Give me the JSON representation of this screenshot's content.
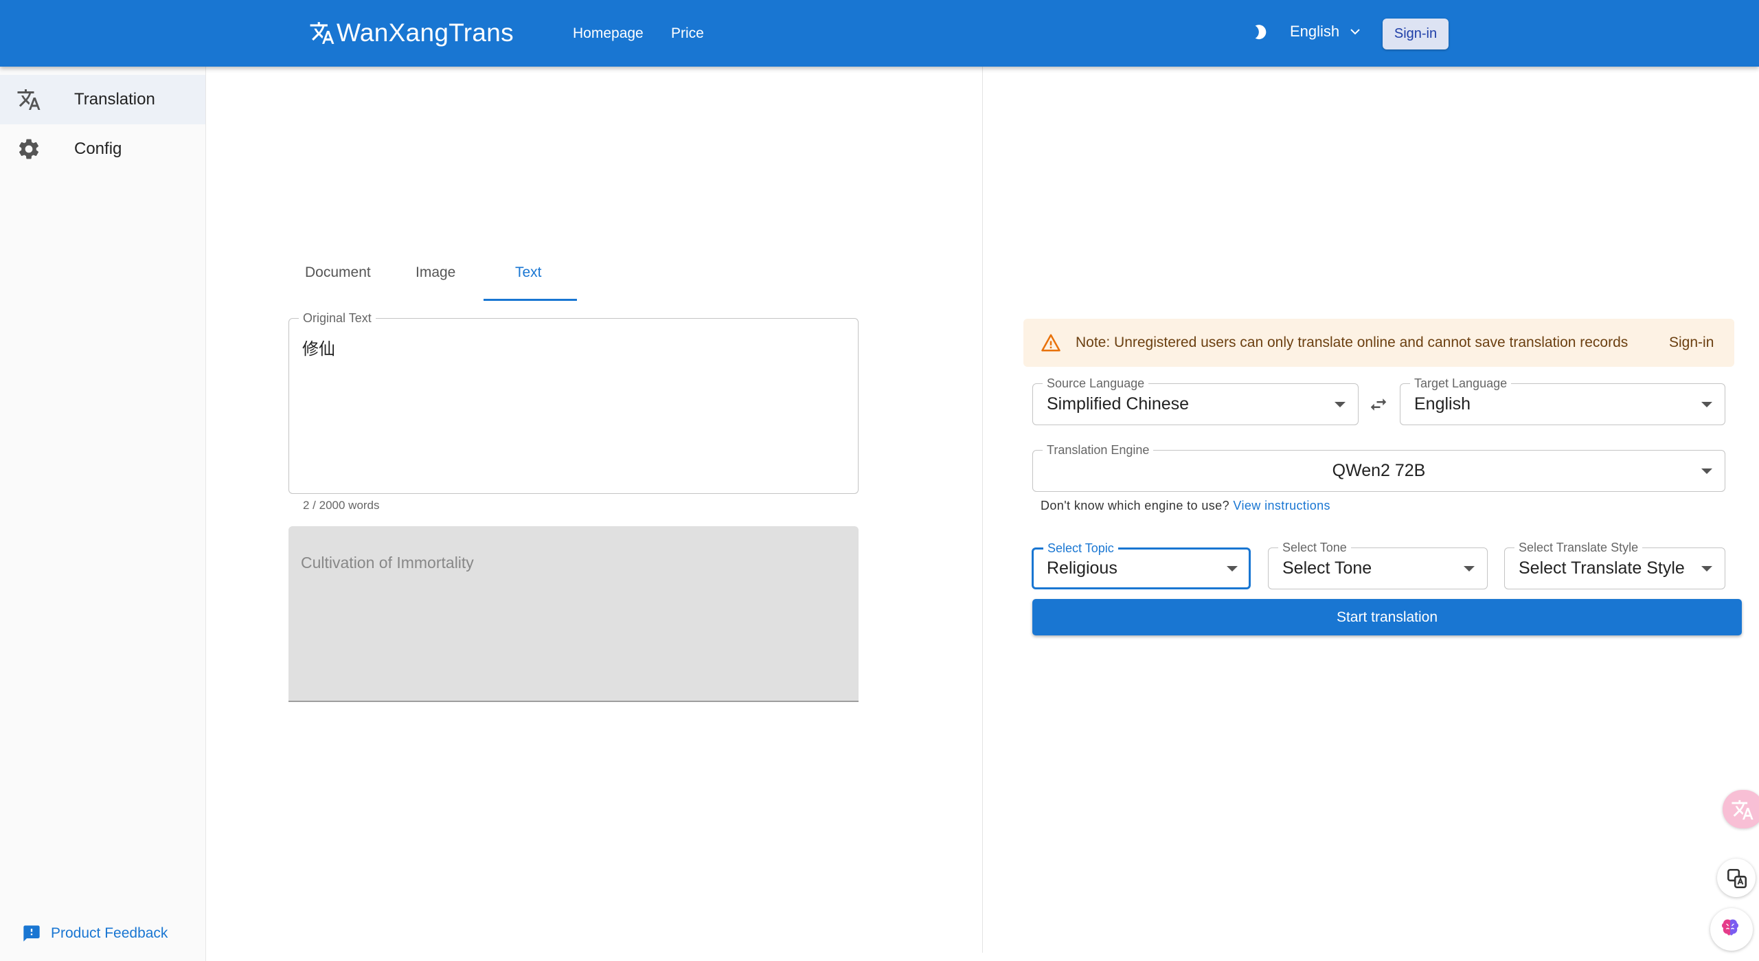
{
  "header": {
    "brand": "WanXangTrans",
    "nav": [
      "Homepage",
      "Price"
    ],
    "language": "English",
    "signin": "Sign-in"
  },
  "sidebar": {
    "items": [
      {
        "label": "Translation",
        "icon": "translate-icon",
        "active": true
      },
      {
        "label": "Config",
        "icon": "gear-icon",
        "active": false
      }
    ],
    "feedback": "Product Feedback"
  },
  "tabs": [
    "Document",
    "Image",
    "Text"
  ],
  "active_tab": "Text",
  "original": {
    "legend": "Original Text",
    "value": "修仙",
    "counter": "2 / 2000 words"
  },
  "result": {
    "value": "Cultivation of Immortality"
  },
  "alert": {
    "message": "Note: Unregistered users can only translate online and cannot save translation records",
    "action": "Sign-in"
  },
  "source_language": {
    "legend": "Source Language",
    "value": "Simplified Chinese"
  },
  "target_language": {
    "legend": "Target Language",
    "value": "English"
  },
  "engine": {
    "legend": "Translation Engine",
    "value": "QWen2 72B"
  },
  "hint": {
    "text": "Don't know which engine to use?",
    "link": "View instructions"
  },
  "topic": {
    "legend": "Select Topic",
    "value": "Religious"
  },
  "tone": {
    "legend": "Select Tone",
    "value": "Select Tone"
  },
  "style": {
    "legend": "Select Translate Style",
    "value": "Select Translate Style"
  },
  "start_button": "Start translation",
  "colors": {
    "primary": "#1976d2",
    "alert_bg": "#fdf2e4",
    "warning": "#e8710a"
  }
}
